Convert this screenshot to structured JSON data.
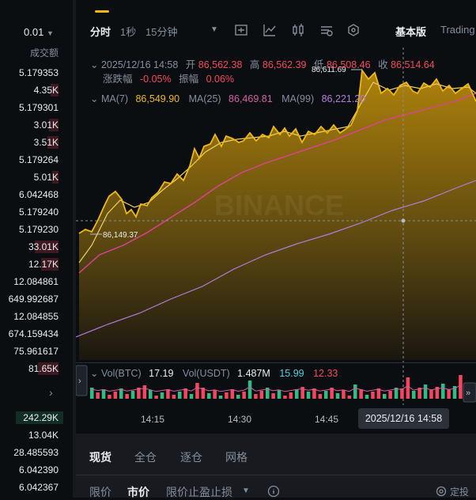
{
  "orderbook": {
    "precision": "0.01",
    "column_header": "成交额",
    "rows": [
      {
        "value": "5.179353",
        "color": "#eaecef"
      },
      {
        "value": "4.35K",
        "color": "#eaecef"
      },
      {
        "value": "5.179301",
        "color": "#eaecef"
      },
      {
        "value": "3.01K",
        "color": "#eaecef"
      },
      {
        "value": "3.51K",
        "color": "#eaecef"
      },
      {
        "value": "5.179264",
        "color": "#eaecef"
      },
      {
        "value": "5.01K",
        "color": "#eaecef"
      },
      {
        "value": "6.042468",
        "color": "#eaecef"
      },
      {
        "value": "5.179240",
        "color": "#eaecef"
      },
      {
        "value": "5.179230",
        "color": "#eaecef"
      },
      {
        "value": "33.01K",
        "color": "#eaecef"
      },
      {
        "value": "12.17K",
        "color": "#eaecef"
      },
      {
        "value": "12.084861",
        "color": "#eaecef"
      },
      {
        "value": "649.992687",
        "color": "#eaecef"
      },
      {
        "value": "12.084855",
        "color": "#eaecef"
      },
      {
        "value": "674.159434",
        "color": "#eaecef"
      },
      {
        "value": "75.961617",
        "color": "#eaecef"
      },
      {
        "value": "81.65K",
        "color": "#eaecef"
      }
    ],
    "bid_rows": [
      {
        "value": "242.29K"
      },
      {
        "value": "13.04K"
      },
      {
        "value": "28.485593"
      },
      {
        "value": "6.042390"
      },
      {
        "value": "6.042367"
      }
    ]
  },
  "toolbar": {
    "tab_time": "分时",
    "tab_1s": "1秒",
    "tab_15m": "15分钟",
    "tab_basic": "基本版",
    "tab_tradingview": "Trading"
  },
  "ohlc": {
    "datetime": "2025/12/16 14:58",
    "open_label": "开",
    "open": "86,562.38",
    "high_label": "高",
    "high": "86,562.39",
    "low_label": "低",
    "low": "86,508.46",
    "close_label": "收",
    "close": "86,514.64",
    "change_label": "涨跌幅",
    "change": "-0.05%",
    "amp_label": "振幅",
    "amp": "0.06%"
  },
  "ma": {
    "ma7_label": "MA(7)",
    "ma7": "86,549.90",
    "ma25_label": "MA(25)",
    "ma25": "86,469.81",
    "ma99_label": "MA(99)",
    "ma99": "86,221.20"
  },
  "annotations": {
    "high_marker": "86,611.69",
    "low_marker": "86,149.37",
    "watermark": "BINANCE"
  },
  "volume": {
    "vol_btc_label": "Vol(BTC)",
    "vol_btc": "17.19",
    "vol_usdt_label": "Vol(USDT)",
    "vol_usdt": "1.487M",
    "v1": "15.99",
    "v2": "12.33"
  },
  "time_axis": {
    "t1": "14:15",
    "t2": "14:30",
    "t3": "14:45",
    "cursor": "2025/12/16 14:58"
  },
  "trade_tabs": {
    "spot": "现货",
    "cross": "全仓",
    "isolated": "逐仓",
    "grid": "网格"
  },
  "order_types": {
    "limit": "限价",
    "market": "市价",
    "stop_limit": "限价止盈止损",
    "dca": "定投"
  },
  "colors": {
    "accent": "#f0b90b",
    "red": "#f6465d",
    "green": "#2ebd85",
    "ma25": "#e0409a",
    "ma99": "#b47bdc"
  }
}
